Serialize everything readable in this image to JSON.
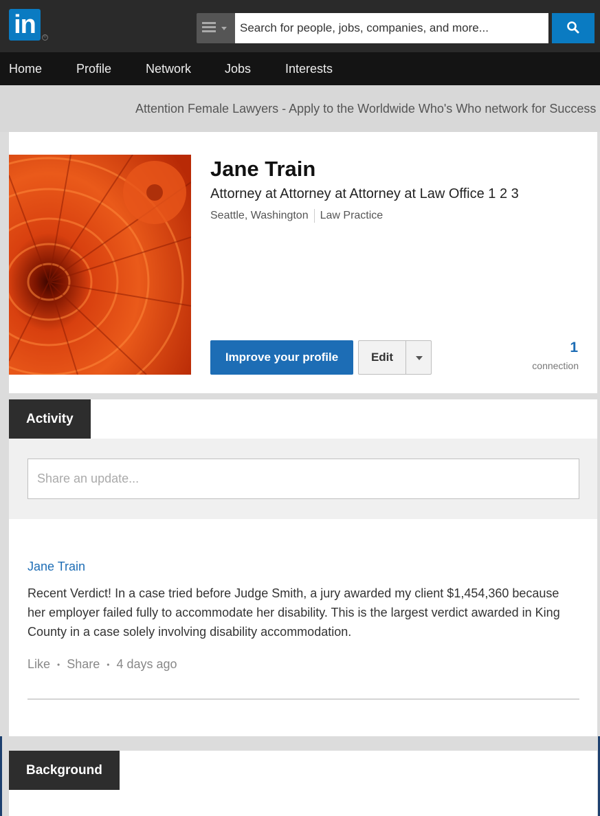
{
  "header": {
    "logo_text": "in",
    "logo_reg": "®",
    "search": {
      "placeholder": "Search for people, jobs, companies, and more..."
    },
    "colors": {
      "brand": "#0a7bc2",
      "topbar": "#2a2a2a",
      "nav": "#141414"
    }
  },
  "nav": {
    "items": [
      {
        "label": "Home"
      },
      {
        "label": "Profile"
      },
      {
        "label": "Network"
      },
      {
        "label": "Jobs"
      },
      {
        "label": "Interests"
      }
    ]
  },
  "announcement": {
    "text": "Attention Female Lawyers - Apply to the Worldwide Who's Who network for Success"
  },
  "profile": {
    "name": "Jane Train",
    "headline": "Attorney at Attorney at Attorney at Law Office 1 2 3",
    "location": "Seattle, Washington",
    "industry": "Law Practice",
    "improve_label": "Improve your profile",
    "edit_label": "Edit",
    "connections_count": "1",
    "connections_label": "connection",
    "photo_icon": "orange-flower-photo"
  },
  "activity": {
    "tab_label": "Activity",
    "share_placeholder": "Share an update...",
    "post": {
      "author": "Jane Train",
      "text": "Recent Verdict! In a case tried before Judge Smith, a jury awarded my client $1,454,360 because her employer failed fully to accommodate her disability. This is the largest verdict awarded in King County in a case solely involving disability accommodation.",
      "like_label": "Like",
      "share_label": "Share",
      "time": "4 days ago"
    }
  },
  "background": {
    "tab_label": "Background"
  }
}
